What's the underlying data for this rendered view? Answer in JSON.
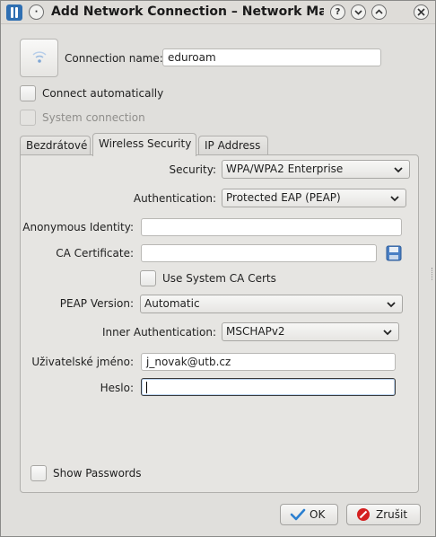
{
  "window": {
    "title": "Add Network Connection – Network Manage",
    "titlebar_buttons": [
      "menu-icon",
      "help-icon",
      "minimize-icon",
      "maximize-icon",
      "close-icon"
    ]
  },
  "connection": {
    "name_label": "Connection name:",
    "name_value": "eduroam",
    "icon": "wireless-icon"
  },
  "options": {
    "connect_automatically": "Connect automatically",
    "system_connection": "System connection"
  },
  "tabs": [
    {
      "label": "Bezdrátové",
      "active": false
    },
    {
      "label": "Wireless Security",
      "active": true
    },
    {
      "label": "IP Address",
      "active": false
    }
  ],
  "security": {
    "security_label": "Security:",
    "security_value": "WPA/WPA2 Enterprise",
    "authentication_label": "Authentication:",
    "authentication_value": "Protected EAP (PEAP)",
    "anonymous_identity_label": "Anonymous Identity:",
    "anonymous_identity_value": "",
    "ca_certificate_label": "CA Certificate:",
    "ca_certificate_value": "",
    "use_system_ca_label": "Use System CA Certs",
    "peap_version_label": "PEAP Version:",
    "peap_version_value": "Automatic",
    "inner_auth_label": "Inner Authentication:",
    "inner_auth_value": "MSCHAPv2",
    "username_label": "Uživatelské jméno:",
    "username_value": "j_novak@utb.cz",
    "password_label": "Heslo:",
    "password_value": "",
    "show_passwords_label": "Show Passwords"
  },
  "buttons": {
    "ok": "OK",
    "cancel": "Zrušit"
  },
  "colors": {
    "accent": "#2f6fb2",
    "ok_check": "#2b7fd0",
    "cancel_red": "#d42020"
  }
}
